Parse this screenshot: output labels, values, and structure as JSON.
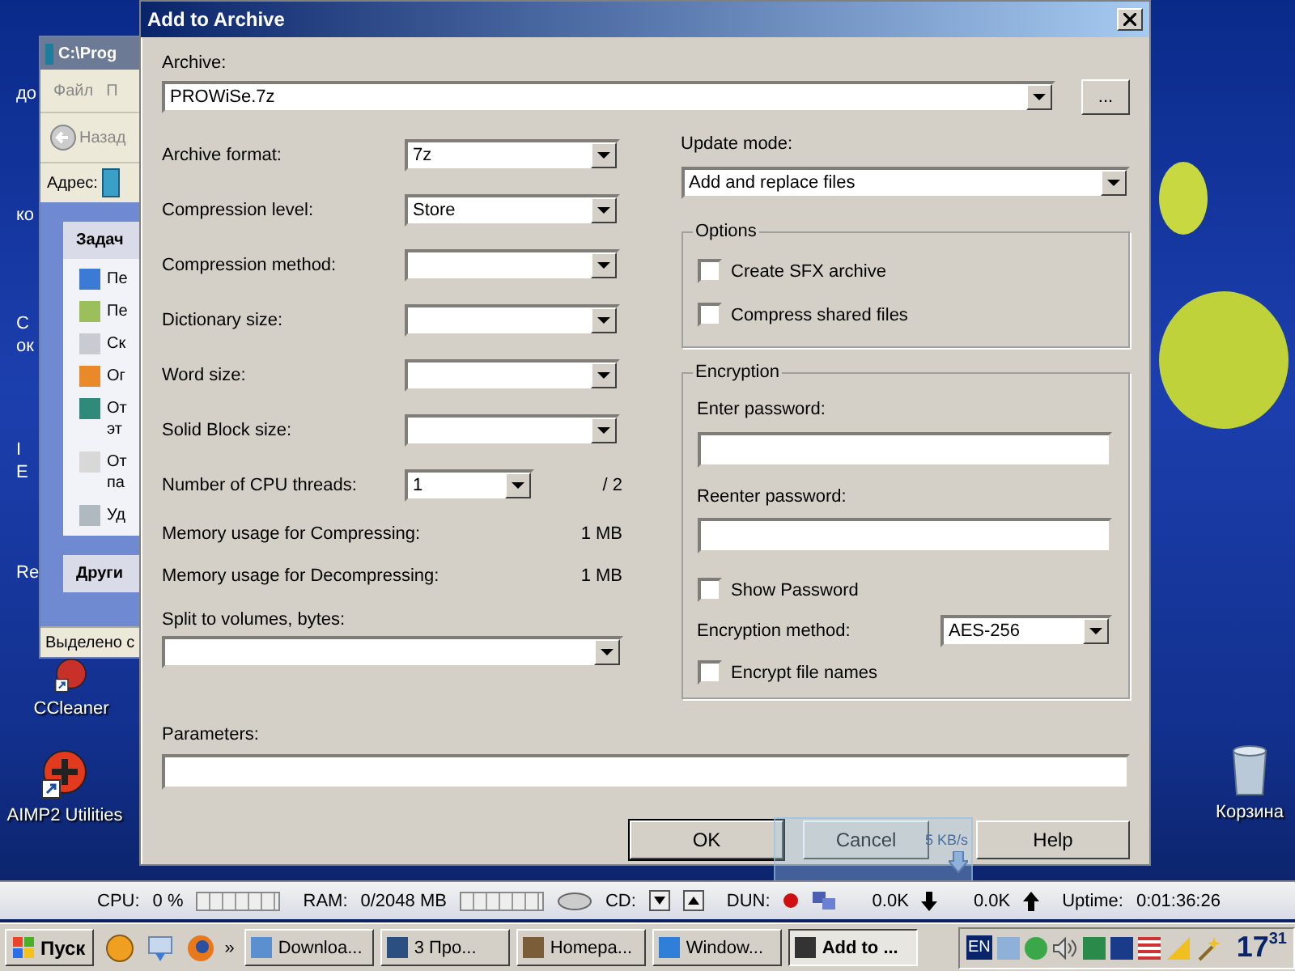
{
  "desktop": {
    "edge_labels": [
      "до",
      "ко",
      "С",
      "ок",
      "I",
      "E",
      "Re"
    ],
    "icons": [
      {
        "label": "CCleaner",
        "kind": "ccleaner"
      },
      {
        "label": "AIMP2 Utilities",
        "kind": "aimp"
      },
      {
        "label": "Корзина",
        "kind": "bin"
      }
    ]
  },
  "explorer": {
    "title": "C:\\Prog",
    "menu": [
      "Файл",
      "П"
    ],
    "back": "Назад",
    "address": "Адрес:",
    "tasks_header": "Задач",
    "tasks": [
      {
        "lines": [
          "Пе"
        ]
      },
      {
        "lines": [
          "Пе"
        ]
      },
      {
        "lines": [
          "Ск"
        ]
      },
      {
        "lines": [
          "Ог"
        ]
      },
      {
        "lines": [
          "От",
          "эт"
        ]
      },
      {
        "lines": [
          "От",
          "па"
        ]
      },
      {
        "lines": [
          "Уд"
        ]
      }
    ],
    "other_header": "Други",
    "status": "Выделено с"
  },
  "dialog": {
    "title": "Add to Archive",
    "archive_label": "Archive:",
    "archive": "PROWiSe.7z",
    "browse": "...",
    "settings": [
      {
        "kind": "combo",
        "label": "Archive format:",
        "value": "7z"
      },
      {
        "kind": "combo",
        "label": "Compression level:",
        "value": "Store"
      },
      {
        "kind": "combo",
        "label": "Compression method:"
      },
      {
        "kind": "combo",
        "label": "Dictionary size:"
      },
      {
        "kind": "combo",
        "label": "Word size:"
      },
      {
        "kind": "combo",
        "label": "Solid Block size:"
      },
      {
        "kind": "threads",
        "label": "Number of CPU threads:",
        "value": "1",
        "total": "/ 2"
      },
      {
        "kind": "info",
        "label": "Memory usage for Compressing:",
        "value": "1 MB"
      },
      {
        "kind": "info",
        "label": "Memory usage for Decompressing:",
        "value": "1 MB"
      }
    ],
    "split_label": "Split to volumes, bytes:",
    "update_label": "Update mode:",
    "update_value": "Add and replace files",
    "options_title": "Options",
    "options": [
      {
        "label": "Create SFX archive",
        "checked": false
      },
      {
        "label": "Compress shared files",
        "checked": false
      }
    ],
    "encryption_title": "Encryption",
    "password_label": "Enter password:",
    "reenter_label": "Reenter password:",
    "show_password": {
      "label": "Show Password",
      "checked": false
    },
    "method_label": "Encryption method:",
    "method_value": "AES-256",
    "encrypt_names": {
      "label": "Encrypt file names",
      "checked": false
    },
    "parameters_label": "Parameters:",
    "buttons": [
      "OK",
      "Cancel",
      "Help"
    ]
  },
  "download_widget": {
    "speed": "5 KB/s"
  },
  "meter_bar": {
    "cpu_label": "CPU:",
    "cpu_value": "0 %",
    "ram_label": "RAM:",
    "ram_value": "0/2048 MB",
    "cd_label": "CD:",
    "dun_label": "DUN:",
    "down": "0.0K",
    "up": "0.0K",
    "uptime_label": "Uptime:",
    "uptime": "0:01:36:26"
  },
  "taskbar": {
    "start": "Пуск",
    "more": "»",
    "buttons": [
      {
        "label": "Downloa...",
        "selected": false
      },
      {
        "label": "3 Про...",
        "selected": false
      },
      {
        "label": "Homepa...",
        "selected": false
      },
      {
        "label": "Window...",
        "selected": false
      },
      {
        "label": "Add to ...",
        "selected": true
      }
    ],
    "language": "EN",
    "clock_hour": "17",
    "clock_minute": "31"
  }
}
